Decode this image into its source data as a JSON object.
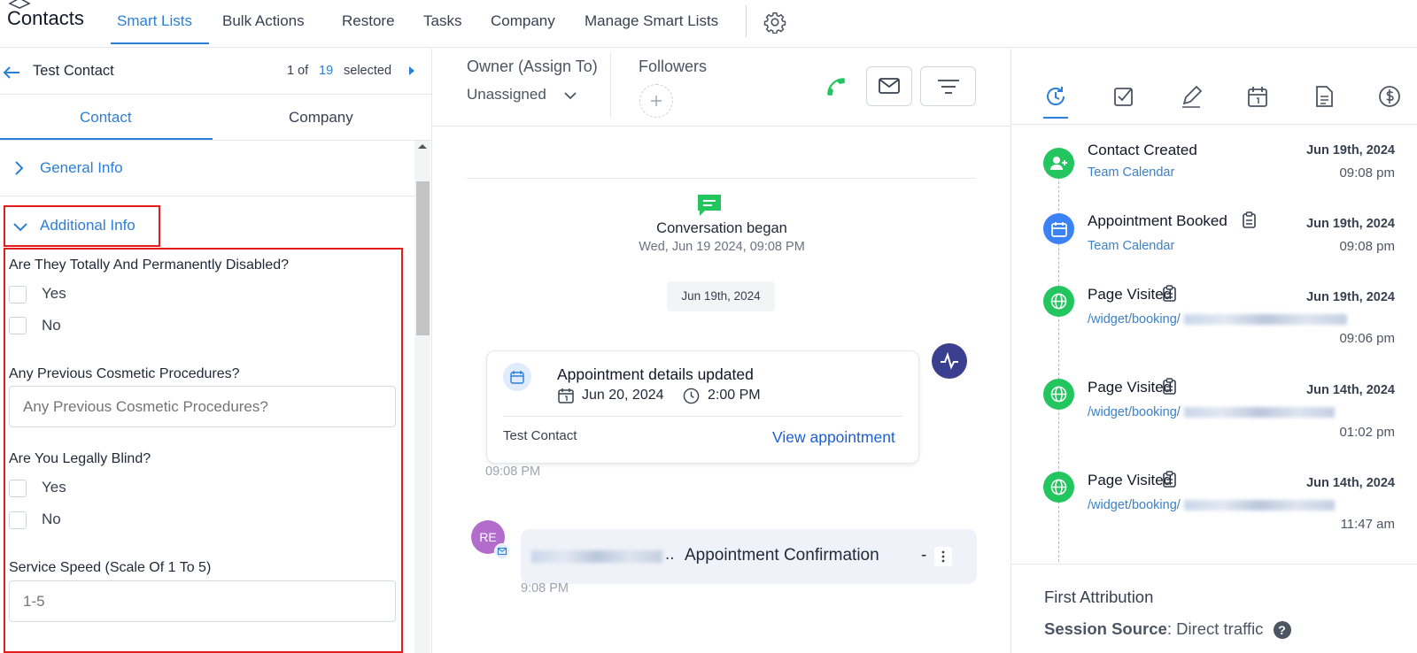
{
  "nav": {
    "title": "Contacts",
    "tabs": [
      "Smart Lists",
      "Bulk Actions",
      "Restore",
      "Tasks",
      "Company",
      "Manage Smart Lists"
    ]
  },
  "left": {
    "contact_name": "Test Contact",
    "pager_prefix": "1 of",
    "pager_count": "19",
    "pager_suffix": "selected",
    "subtabs": [
      "Contact",
      "Company"
    ],
    "general_info": "General Info",
    "additional_info": "Additional Info",
    "q1": "Are They Totally And Permanently Disabled?",
    "q1_options": [
      "Yes",
      "No"
    ],
    "q2": "Any Previous Cosmetic Procedures?",
    "q2_placeholder": "Any Previous Cosmetic Procedures?",
    "q3": "Are You Legally Blind?",
    "q3_options": [
      "Yes",
      "No"
    ],
    "q4": "Service Speed (Scale Of 1 To 5)",
    "q4_placeholder": "1-5"
  },
  "middle": {
    "owner_label": "Owner (Assign To)",
    "owner_value": "Unassigned",
    "followers_label": "Followers",
    "conv_began": "Conversation began",
    "conv_date": "Wed, Jun 19 2024, 09:08 PM",
    "date_chip": "Jun 19th, 2024",
    "card": {
      "title": "Appointment details updated",
      "date": "Jun 20, 2024",
      "time": "2:00 PM",
      "contact": "Test Contact",
      "link": "View appointment"
    },
    "card_time": "09:08 PM",
    "avatar_initials": "RE",
    "msg_subject": "Appointment Confirmation",
    "msg_ellipsis": "..",
    "msg_dash": "-",
    "msg_time": "9:08 PM"
  },
  "right": {
    "events": [
      {
        "title": "Contact Created",
        "sub": "Team Calendar",
        "date": "Jun 19th, 2024",
        "time": "09:08 pm"
      },
      {
        "title": "Appointment Booked",
        "sub": "Team Calendar",
        "date": "Jun 19th, 2024",
        "time": "09:08 pm"
      },
      {
        "title": "Page Visited",
        "sub": "/widget/booking/",
        "date": "Jun 19th, 2024",
        "time": "09:06 pm"
      },
      {
        "title": "Page Visited",
        "sub": "/widget/booking/",
        "date": "Jun 14th, 2024",
        "time": "01:02 pm"
      },
      {
        "title": "Page Visited",
        "sub": "/widget/booking/",
        "date": "Jun 14th, 2024",
        "time": "11:47 am"
      }
    ],
    "attribution_title": "First Attribution",
    "session_source_label": "Session Source",
    "session_source_value": ": Direct traffic"
  },
  "colors": {
    "accent": "#2b7fd8",
    "green": "#22c55e",
    "blue_dot": "#3b82f6",
    "highlight": "#e11d1d",
    "avatar": "#b26cc9",
    "activity": "#3b3f8f"
  }
}
